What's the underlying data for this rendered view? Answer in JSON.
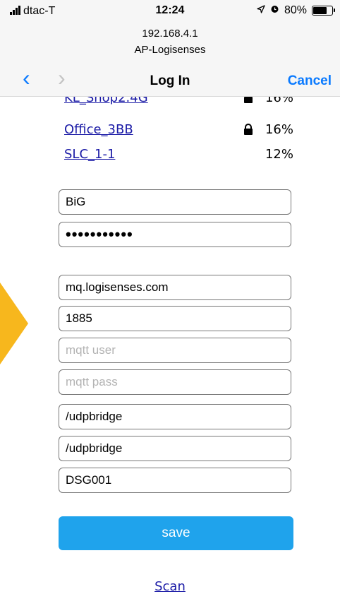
{
  "status_bar": {
    "carrier": "dtac-T",
    "time": "12:24",
    "battery": "80%",
    "battery_level": 0.8,
    "icons": [
      "signal-bars-icon",
      "location-arrow-icon",
      "alarm-icon",
      "battery-icon"
    ]
  },
  "browser": {
    "url": "192.168.4.1",
    "site_name": "AP-Logisenses"
  },
  "nav": {
    "back_icon": "chevron-left-icon",
    "forward_icon": "chevron-right-icon",
    "title": "Log In",
    "cancel": "Cancel"
  },
  "networks": [
    {
      "ssid": "KL_Shop2.4G",
      "secured": true,
      "signal": "16%"
    },
    {
      "ssid": "Office_3BB",
      "secured": true,
      "signal": "16%"
    },
    {
      "ssid": "SLC_1-1",
      "secured": false,
      "signal": "12%"
    }
  ],
  "form": {
    "ssid_value": "BiG",
    "password_value": "•••••••••••",
    "mqtt_server_value": "mq.logisenses.com",
    "mqtt_port_value": "1885",
    "mqtt_user_placeholder": "mqtt user",
    "mqtt_pass_placeholder": "mqtt pass",
    "topic_1_value": "/udpbridge",
    "topic_2_value": "/udpbridge",
    "device_id_value": "DSG001",
    "save_label": "save"
  },
  "scan_label": "Scan",
  "colors": {
    "ios_blue": "#0a7aff",
    "link_blue": "#1a1aa6",
    "save_button": "#1fa3ec",
    "arrow_accent": "#f7b71d"
  }
}
